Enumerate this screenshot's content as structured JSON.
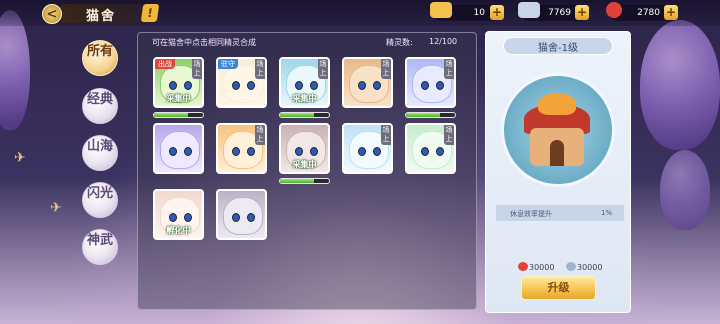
{
  "header": {
    "title": "猫舍",
    "info_label": "!",
    "back_label": "<"
  },
  "currencies": [
    {
      "icon": "gold-ingot-icon",
      "value": "10",
      "color": "#f2c14e"
    },
    {
      "icon": "silver-ingot-icon",
      "value": "7769",
      "color": "#c9d3e6"
    },
    {
      "icon": "red-gem-icon",
      "value": "2780",
      "color": "#e2413b"
    }
  ],
  "plus_label": "+",
  "tabs": [
    {
      "label": "所有",
      "active": true
    },
    {
      "label": "经典",
      "active": false
    },
    {
      "label": "山海",
      "active": false
    },
    {
      "label": "闪光",
      "active": false
    },
    {
      "label": "神武",
      "active": false
    }
  ],
  "panel": {
    "hint": "可在猫舍中点击相同精灵合成",
    "count_label": "精灵数:",
    "count_value": "12/100"
  },
  "cats": [
    {
      "color": "#8bd06a",
      "face": "#e9f7d2",
      "tag_left": "出战",
      "tag_left_color": "#e0463a",
      "tag_right": "场上",
      "status": "采集中",
      "progress": 0.7
    },
    {
      "color": "#f6eed7",
      "face": "#fff7e6",
      "tag_left": "驻守",
      "tag_left_color": "#3a86d8",
      "tag_right": "场上",
      "status": "",
      "progress": null
    },
    {
      "color": "#9fd7e8",
      "face": "#eaf7fb",
      "tag_left": "",
      "tag_left_color": "",
      "tag_right": "场上",
      "status": "采集中",
      "progress": 0.7
    },
    {
      "color": "#e7b98a",
      "face": "#f7e2c8",
      "tag_left": "",
      "tag_left_color": "",
      "tag_right": "场上",
      "status": "",
      "progress": null
    },
    {
      "color": "#aeb8f2",
      "face": "#e8ebff",
      "tag_left": "",
      "tag_left_color": "",
      "tag_right": "场上",
      "status": "",
      "progress": 0.7
    },
    {
      "color": "#b7a6e8",
      "face": "#efeaff",
      "tag_left": "",
      "tag_left_color": "",
      "tag_right": "",
      "status": "",
      "progress": null
    },
    {
      "color": "#f7c17f",
      "face": "#fff0da",
      "tag_left": "",
      "tag_left_color": "",
      "tag_right": "场上",
      "status": "",
      "progress": null
    },
    {
      "color": "#c9b2b2",
      "face": "#f2e7e7",
      "tag_left": "",
      "tag_left_color": "",
      "tag_right": "",
      "status": "采集中",
      "progress": 0.7
    },
    {
      "color": "#bfe0f2",
      "face": "#f3fbff",
      "tag_left": "",
      "tag_left_color": "",
      "tag_right": "场上",
      "status": "",
      "progress": null
    },
    {
      "color": "#c6eccf",
      "face": "#f0fbf2",
      "tag_left": "",
      "tag_left_color": "",
      "tag_right": "场上",
      "status": "",
      "progress": null
    },
    {
      "color": "#f1d9cf",
      "face": "#fff4ef",
      "tag_left": "",
      "tag_left_color": "",
      "tag_right": "",
      "status": "孵化中",
      "progress": null
    },
    {
      "color": "#b9b3c6",
      "face": "#eeeaf4",
      "tag_left": "",
      "tag_left_color": "",
      "tag_right": "",
      "status": "",
      "progress": null
    }
  ],
  "house": {
    "title": "猫舍-1级",
    "stat_label": "休息效率提升",
    "stat_value": "1%",
    "cost_red": "30000",
    "cost_silver": "30000",
    "upgrade_label": "升级"
  }
}
